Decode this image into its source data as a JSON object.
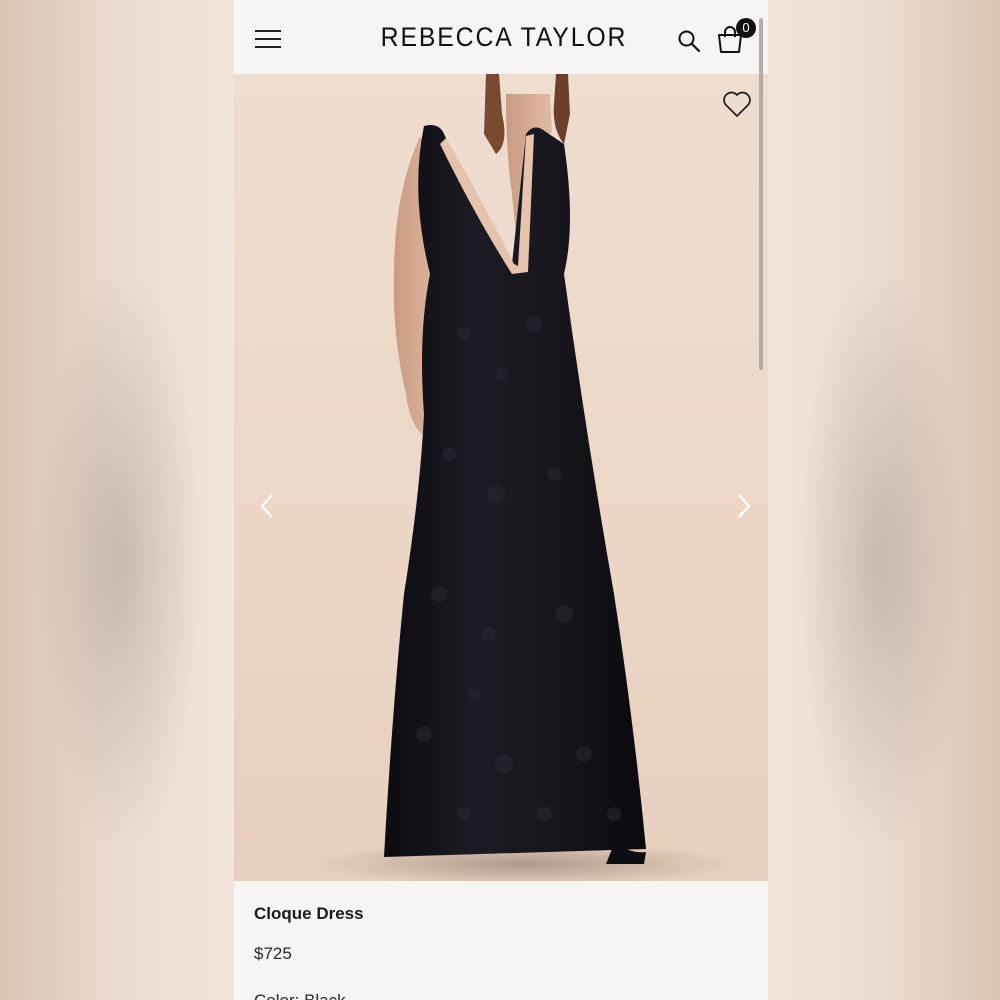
{
  "header": {
    "brand": "REBECCA TAYLOR",
    "cart_count": "0",
    "icons": [
      "menu-icon",
      "search-icon",
      "shopping-bag-icon"
    ]
  },
  "gallery": {
    "icons": [
      "heart-icon",
      "chevron-left-icon",
      "chevron-right-icon"
    ]
  },
  "product": {
    "name": "Cloque Dress",
    "price": "$725",
    "color": "Color: Black"
  },
  "colors": {
    "background": "#f7f5f3",
    "photo_backdrop": "#ecd7c7",
    "dress": "#15141a",
    "text": "#1a1a1a"
  }
}
